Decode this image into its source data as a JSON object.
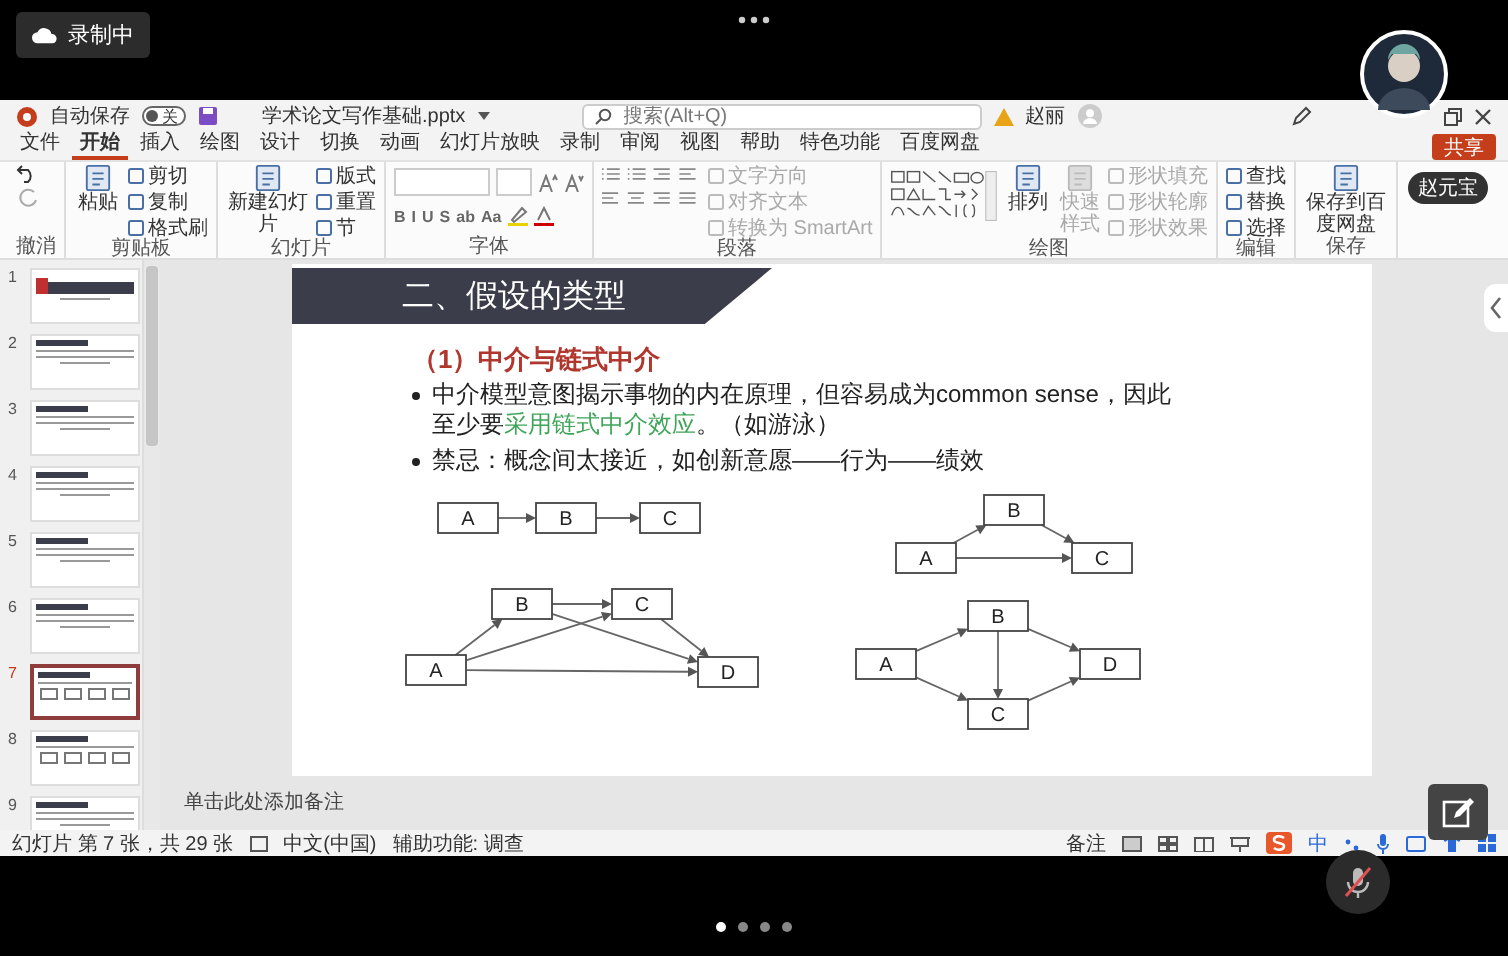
{
  "recording": {
    "label": "录制中"
  },
  "call": {
    "participant": "赵元宝",
    "mic_muted": true,
    "pages": [
      {
        "selected": true
      },
      {
        "selected": false
      },
      {
        "selected": false
      },
      {
        "selected": false
      }
    ]
  },
  "app": {
    "autosave": {
      "label": "自动保存",
      "on": false,
      "state_text": "关"
    },
    "filename": "学术论文写作基础.pptx",
    "search": {
      "placeholder": "搜索(Alt+Q)"
    },
    "user": "赵丽",
    "menu": [
      {
        "label": "文件",
        "selected": false
      },
      {
        "label": "开始",
        "selected": true
      },
      {
        "label": "插入",
        "selected": false
      },
      {
        "label": "绘图",
        "selected": false
      },
      {
        "label": "设计",
        "selected": false
      },
      {
        "label": "切换",
        "selected": false
      },
      {
        "label": "动画",
        "selected": false
      },
      {
        "label": "幻灯片放映",
        "selected": false
      },
      {
        "label": "录制",
        "selected": false
      },
      {
        "label": "审阅",
        "selected": false
      },
      {
        "label": "视图",
        "selected": false
      },
      {
        "label": "帮助",
        "selected": false
      },
      {
        "label": "特色功能",
        "selected": false
      },
      {
        "label": "百度网盘",
        "selected": false
      }
    ],
    "share": "共享",
    "ribbon": [
      {
        "label": "撤消",
        "items": [
          {
            "kind": "undo"
          }
        ]
      },
      {
        "label": "剪贴板",
        "items": [
          {
            "kind": "big",
            "label": "粘贴",
            "disabled": false
          },
          {
            "kind": "stack",
            "entries": [
              {
                "label": "剪切",
                "disabled": false
              },
              {
                "label": "复制",
                "disabled": false
              },
              {
                "label": "格式刷",
                "disabled": false
              }
            ]
          }
        ]
      },
      {
        "label": "幻灯片",
        "items": [
          {
            "kind": "big",
            "label": "新建幻灯片",
            "disabled": false
          },
          {
            "kind": "stack",
            "entries": [
              {
                "label": "版式",
                "disabled": false
              },
              {
                "label": "重置",
                "disabled": false
              },
              {
                "label": "节",
                "disabled": false
              }
            ]
          }
        ]
      },
      {
        "label": "字体",
        "items": [
          {
            "kind": "fontpanel",
            "glyphs": [
              "B",
              "I",
              "U",
              "S",
              "ab",
              "Aa"
            ]
          }
        ]
      },
      {
        "label": "段落",
        "items": [
          {
            "kind": "parapanel"
          },
          {
            "kind": "stack",
            "entries": [
              {
                "label": "文字方向",
                "disabled": true
              },
              {
                "label": "对齐文本",
                "disabled": true
              },
              {
                "label": "转换为 SmartArt",
                "disabled": true
              }
            ]
          }
        ]
      },
      {
        "label": "绘图",
        "items": [
          {
            "kind": "shapes"
          },
          {
            "kind": "big",
            "label": "排列",
            "disabled": false
          },
          {
            "kind": "big",
            "label": "快速样式",
            "disabled": true
          },
          {
            "kind": "stack",
            "entries": [
              {
                "label": "形状填充",
                "disabled": true
              },
              {
                "label": "形状轮廓",
                "disabled": true
              },
              {
                "label": "形状效果",
                "disabled": true
              }
            ]
          }
        ]
      },
      {
        "label": "编辑",
        "items": [
          {
            "kind": "stack",
            "entries": [
              {
                "label": "查找",
                "disabled": false
              },
              {
                "label": "替换",
                "disabled": false
              },
              {
                "label": "选择",
                "disabled": false
              }
            ]
          }
        ]
      },
      {
        "label": "保存",
        "items": [
          {
            "kind": "big",
            "label": "保存到百度网盘",
            "disabled": false
          }
        ]
      }
    ]
  },
  "thumbnails": [
    {
      "number": "1",
      "kind": "title",
      "selected": false
    },
    {
      "number": "2",
      "kind": "text",
      "selected": false
    },
    {
      "number": "3",
      "kind": "text",
      "selected": false
    },
    {
      "number": "4",
      "kind": "text",
      "selected": false
    },
    {
      "number": "5",
      "kind": "text",
      "selected": false
    },
    {
      "number": "6",
      "kind": "text",
      "selected": false
    },
    {
      "number": "7",
      "kind": "diagram",
      "selected": true
    },
    {
      "number": "8",
      "kind": "diagram",
      "selected": false
    },
    {
      "number": "9",
      "kind": "text",
      "selected": false
    }
  ],
  "slide": {
    "title": "二、假设的类型",
    "subtitle": "（1）中介与链式中介",
    "bullets": [
      {
        "parts": [
          {
            "text": "中介模型意图揭示事物的内在原理，但容易成为common sense，因此至少要",
            "kind": "plain"
          },
          {
            "text": "采用链式中介效应",
            "kind": "accent"
          },
          {
            "text": "。（如游泳）",
            "kind": "plain"
          }
        ]
      },
      {
        "parts": [
          {
            "text": "禁忌：概念间太接近，如创新意愿——行为——绩效",
            "kind": "plain"
          }
        ]
      }
    ],
    "diagrams": [
      {
        "kind": "chain",
        "nodes": [
          "A",
          "B",
          "C"
        ]
      },
      {
        "kind": "triangle",
        "nodes": [
          "A",
          "B",
          "C"
        ]
      },
      {
        "kind": "full",
        "nodes": [
          "A",
          "B",
          "C",
          "D"
        ]
      },
      {
        "kind": "diamond",
        "nodes": [
          "A",
          "B",
          "C",
          "D"
        ]
      }
    ]
  },
  "notes_placeholder": "单击此处添加备注",
  "status": {
    "slide_info": "幻灯片 第 7 张，共 29 张",
    "language": "中文(中国)",
    "accessibility": "辅助功能: 调查",
    "notes": "备注",
    "ime": "中"
  }
}
